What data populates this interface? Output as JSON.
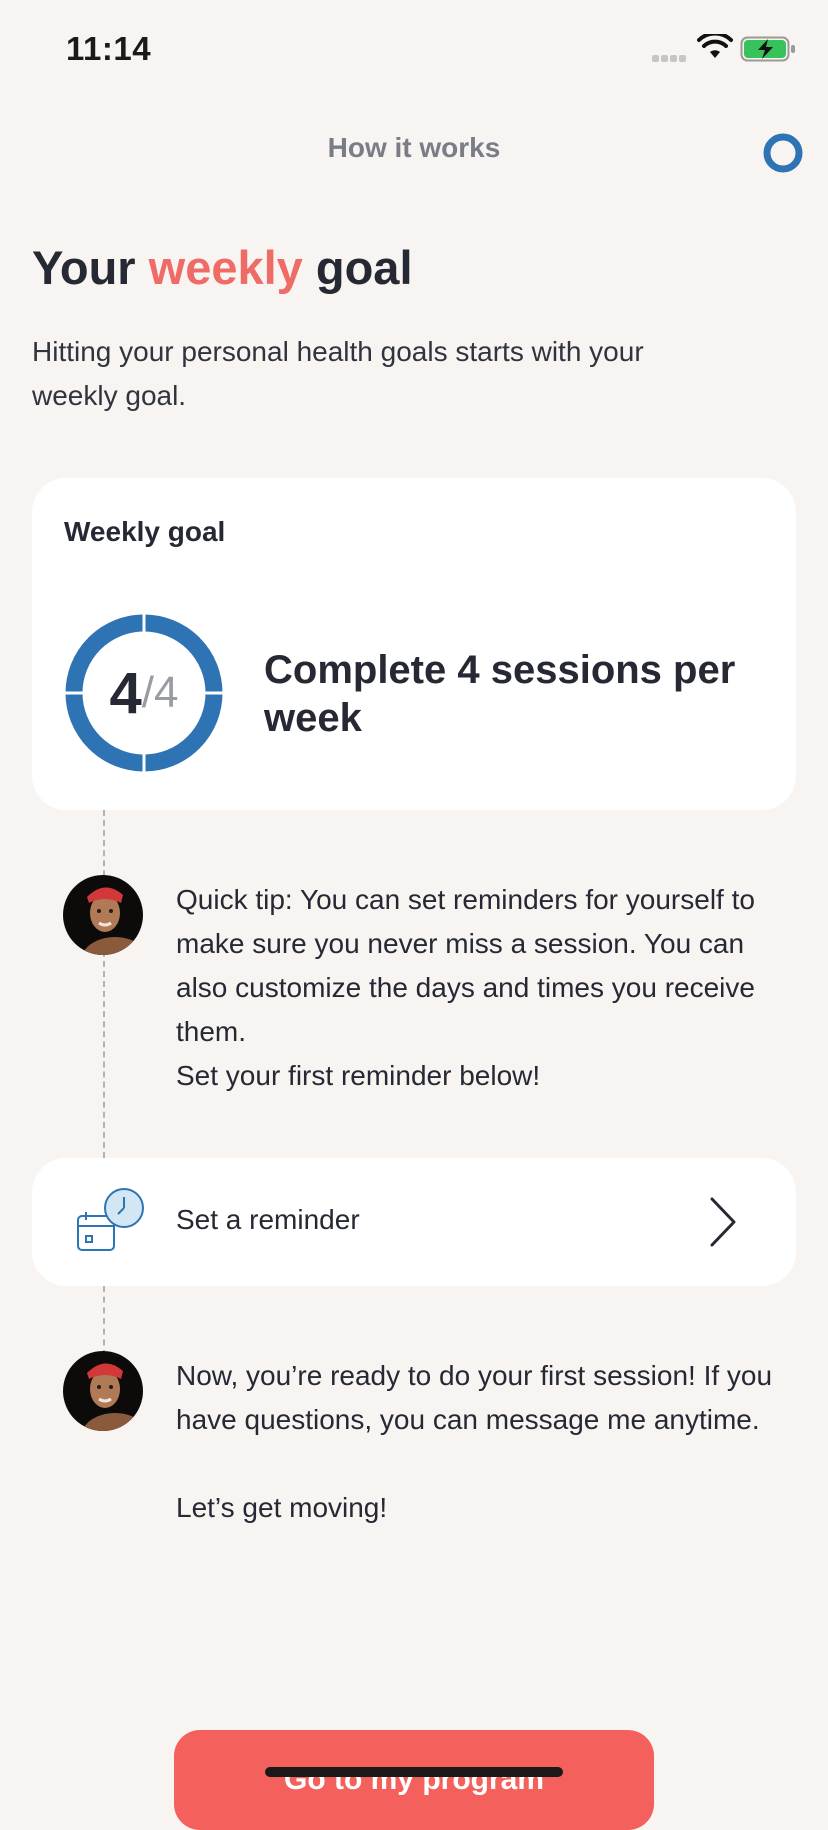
{
  "status_bar": {
    "time": "11:14"
  },
  "nav": {
    "title": "How it works"
  },
  "header": {
    "title_before": "Your ",
    "title_accent": "weekly",
    "title_after": " goal",
    "subtitle": "Hitting your personal health goals starts with your weekly goal."
  },
  "goal_card": {
    "label": "Weekly goal",
    "completed": "4",
    "total": "/4",
    "progress_fraction": 1.0,
    "description": "Complete 4 sessions per week"
  },
  "messages": [
    {
      "lines": [
        "Quick tip: You can set reminders for yourself to make sure you never miss a session. You can also customize the days and times you receive them.",
        "Set your first reminder below!"
      ]
    },
    {
      "lines": [
        "Now, you’re ready to do your first session! If you have questions, you can message me anytime.",
        "Let’s get moving!"
      ]
    }
  ],
  "reminder": {
    "label": "Set a reminder"
  },
  "cta": {
    "label": "Go to my program"
  },
  "colors": {
    "accent": "#ef6b66",
    "ring": "#2e74b5",
    "cta": "#f4615d",
    "background": "#f7f4f2"
  }
}
